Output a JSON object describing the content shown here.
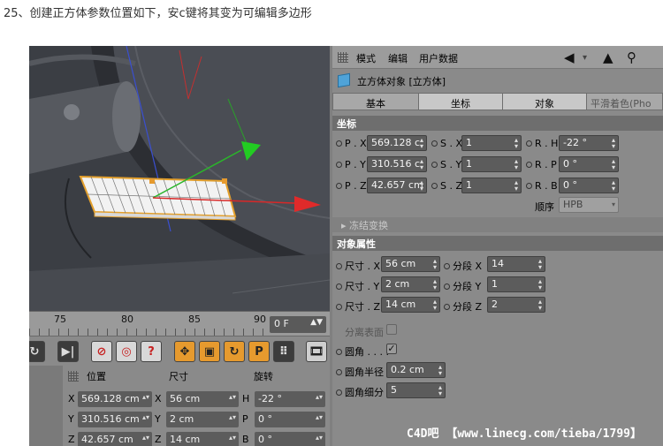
{
  "caption": "25、创建正方体参数位置如下，安c键将其变为可编辑多边形",
  "timeline": {
    "ticks": [
      "75",
      "80",
      "85",
      "90"
    ],
    "frame_value": "0 F"
  },
  "toolbar": {
    "play_end_label": "▶|",
    "move_label": "✥",
    "scale_label": "▣",
    "rotate_label": "↻",
    "param_label": "P",
    "grid_label": "⠿",
    "film_label": "🎞"
  },
  "coord_panel": {
    "headers": {
      "position": "位置",
      "size": "尺寸",
      "rotation": "旋转"
    },
    "rows": [
      {
        "axis": "X",
        "position": "569.128 cm",
        "size_axis": "X",
        "size": "56 cm",
        "rot_axis": "H",
        "rotation": "-22 °"
      },
      {
        "axis": "Y",
        "position": "310.516 cm",
        "size_axis": "Y",
        "size": "2 cm",
        "rot_axis": "P",
        "rotation": "0 °"
      },
      {
        "axis": "Z",
        "position": "42.657 cm",
        "size_axis": "Z",
        "size": "14 cm",
        "rot_axis": "B",
        "rotation": "0 °"
      }
    ]
  },
  "attr": {
    "menu": [
      "模式",
      "编辑",
      "用户数据"
    ],
    "object_title": "立方体对象 [立方体]",
    "tabs": [
      "基本",
      "坐标",
      "对象",
      "平滑着色(Pho"
    ],
    "coord_section": "坐标",
    "coords": [
      {
        "p_label": "P . X",
        "p": "569.128 c",
        "s_label": "S . X",
        "s": "1",
        "r_label": "R . H",
        "r": "-22 °"
      },
      {
        "p_label": "P . Y",
        "p": "310.516 c",
        "s_label": "S . Y",
        "s": "1",
        "r_label": "R . P",
        "r": "0 °"
      },
      {
        "p_label": "P . Z",
        "p": "42.657 cm",
        "s_label": "S . Z",
        "s": "1",
        "r_label": "R . B",
        "r": "0 °"
      }
    ],
    "order_label": "顺序",
    "order_value": "HPB",
    "freeze_label": "▸ 冻结变换",
    "object_section": "对象属性",
    "sizes": [
      {
        "label": "尺寸 . X",
        "value": "56 cm",
        "seg_label": "分段 X",
        "seg": "14"
      },
      {
        "label": "尺寸 . Y",
        "value": "2 cm",
        "seg_label": "分段 Y",
        "seg": "1"
      },
      {
        "label": "尺寸 . Z",
        "value": "14 cm",
        "seg_label": "分段 Z",
        "seg": "2"
      }
    ],
    "separate_label": "分离表面",
    "fillet_label": "圆角 . . . .",
    "fillet_check": "✓",
    "fillet_radius_label": "圆角半径",
    "fillet_radius": "0.2 cm",
    "fillet_sub_label": "圆角细分",
    "fillet_sub": "5"
  },
  "watermark": "C4D吧 【www.linecg.com/tieba/1799】"
}
